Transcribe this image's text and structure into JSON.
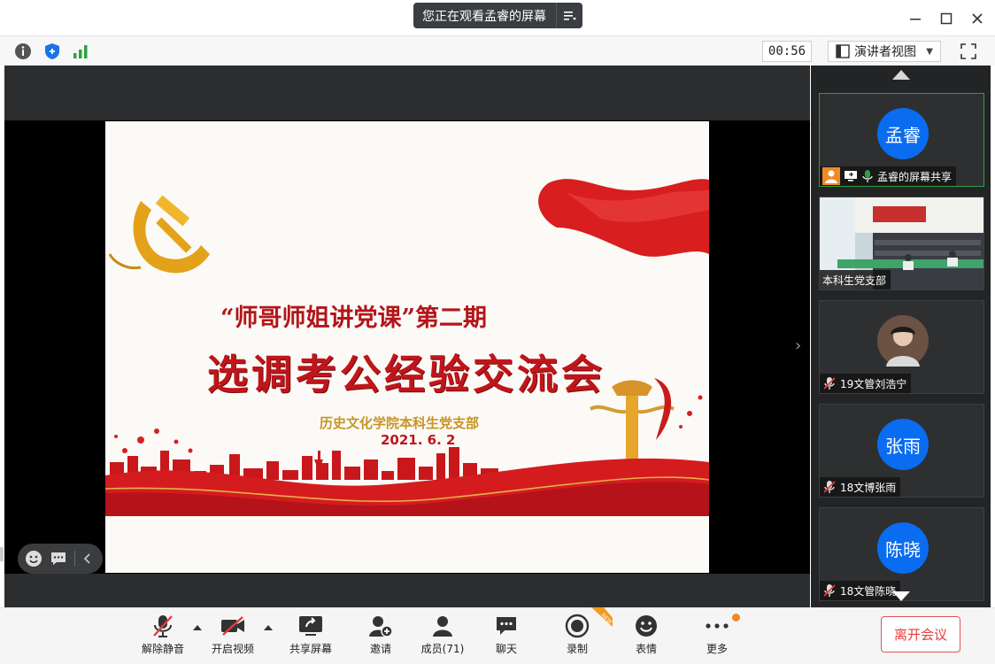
{
  "titlebar": {
    "banner_text": "您正在观看孟睿的屏幕",
    "minimize": "—",
    "maximize": "☐",
    "close": "✕"
  },
  "toolbar": {
    "timer": "00:56",
    "view_label": "演讲者视图"
  },
  "slide": {
    "line1": "“师哥师姐讲党课”第二期",
    "line2": "选调考公经验交流会",
    "line3": "历史文化学院本科生党支部",
    "line4": "2021. 6. 2"
  },
  "sidebar": {
    "tiles": [
      {
        "avatar": "孟睿",
        "label": "孟睿的屏幕共享"
      },
      {
        "label": "本科生党支部"
      },
      {
        "label": "19文管刘浩宁"
      },
      {
        "avatar": "张雨",
        "label": "18文博张雨"
      },
      {
        "avatar": "陈晓",
        "label": "18文管陈晓"
      }
    ]
  },
  "bottombar": {
    "unmute": "解除静音",
    "video": "开启视频",
    "share": "共享屏幕",
    "invite": "邀请",
    "members": "成员(71)",
    "chat": "聊天",
    "record": "录制",
    "emoji": "表情",
    "more": "更多",
    "leave": "离开会议",
    "new_badge": "NEW"
  },
  "colors": {
    "accent_blue": "#0a6cf0",
    "leave_red": "#e53c3c",
    "active_green": "#2ea043",
    "record_badge": "#f39a1e"
  }
}
